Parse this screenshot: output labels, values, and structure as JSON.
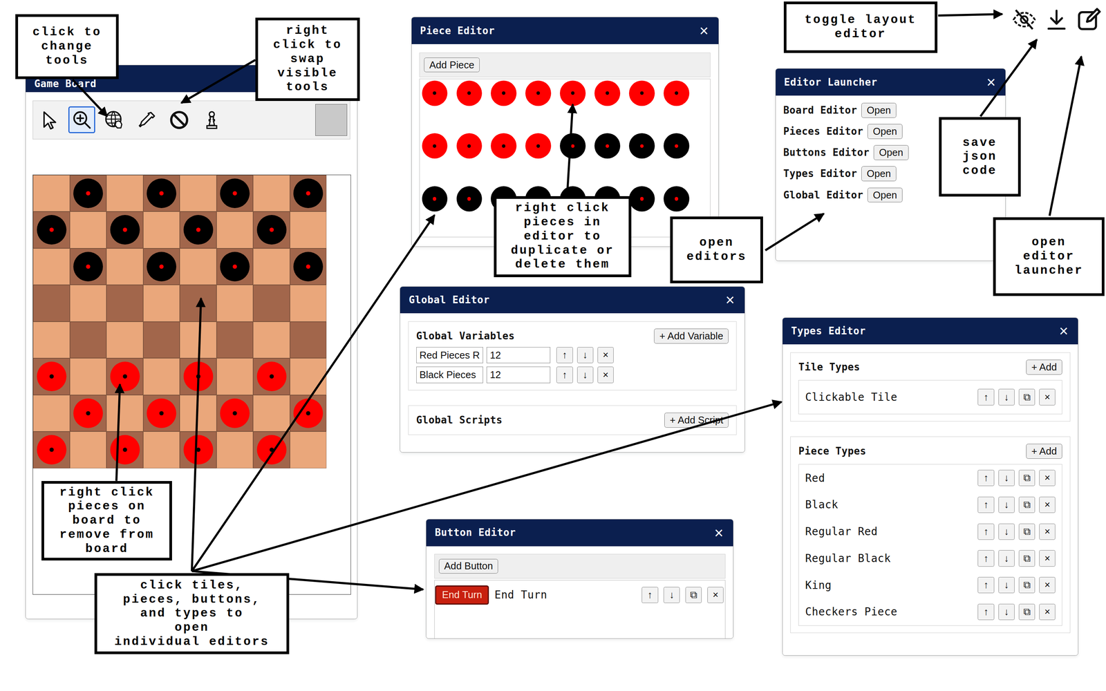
{
  "game_board": {
    "title": "Game Board",
    "tools": [
      {
        "kind": "pointer",
        "selected": false
      },
      {
        "kind": "zoom",
        "selected": true
      },
      {
        "kind": "pan",
        "selected": false
      },
      {
        "kind": "eyedropper",
        "selected": false
      },
      {
        "kind": "erase",
        "selected": false
      },
      {
        "kind": "piece",
        "selected": false
      }
    ],
    "board": [
      [
        {
          "kind": "light",
          "piece": "none"
        },
        {
          "kind": "dark",
          "piece": "black"
        },
        {
          "kind": "light",
          "piece": "none"
        },
        {
          "kind": "dark",
          "piece": "black"
        },
        {
          "kind": "light",
          "piece": "none"
        },
        {
          "kind": "dark",
          "piece": "black"
        },
        {
          "kind": "light",
          "piece": "none"
        },
        {
          "kind": "dark",
          "piece": "black"
        }
      ],
      [
        {
          "kind": "dark",
          "piece": "black"
        },
        {
          "kind": "light",
          "piece": "none"
        },
        {
          "kind": "dark",
          "piece": "black"
        },
        {
          "kind": "light",
          "piece": "none"
        },
        {
          "kind": "dark",
          "piece": "black"
        },
        {
          "kind": "light",
          "piece": "none"
        },
        {
          "kind": "dark",
          "piece": "black"
        },
        {
          "kind": "light",
          "piece": "none"
        }
      ],
      [
        {
          "kind": "light",
          "piece": "none"
        },
        {
          "kind": "dark",
          "piece": "black"
        },
        {
          "kind": "light",
          "piece": "none"
        },
        {
          "kind": "dark",
          "piece": "black"
        },
        {
          "kind": "light",
          "piece": "none"
        },
        {
          "kind": "dark",
          "piece": "black"
        },
        {
          "kind": "light",
          "piece": "none"
        },
        {
          "kind": "dark",
          "piece": "black"
        }
      ],
      [
        {
          "kind": "dark",
          "piece": "none"
        },
        {
          "kind": "light",
          "piece": "none"
        },
        {
          "kind": "dark",
          "piece": "none"
        },
        {
          "kind": "light",
          "piece": "none"
        },
        {
          "kind": "dark",
          "piece": "none"
        },
        {
          "kind": "light",
          "piece": "none"
        },
        {
          "kind": "dark",
          "piece": "none"
        },
        {
          "kind": "light",
          "piece": "none"
        }
      ],
      [
        {
          "kind": "light",
          "piece": "none"
        },
        {
          "kind": "dark",
          "piece": "none"
        },
        {
          "kind": "light",
          "piece": "none"
        },
        {
          "kind": "dark",
          "piece": "none"
        },
        {
          "kind": "light",
          "piece": "none"
        },
        {
          "kind": "dark",
          "piece": "none"
        },
        {
          "kind": "light",
          "piece": "none"
        },
        {
          "kind": "dark",
          "piece": "none"
        }
      ],
      [
        {
          "kind": "dark",
          "piece": "red"
        },
        {
          "kind": "light",
          "piece": "none"
        },
        {
          "kind": "dark",
          "piece": "red"
        },
        {
          "kind": "light",
          "piece": "none"
        },
        {
          "kind": "dark",
          "piece": "red"
        },
        {
          "kind": "light",
          "piece": "none"
        },
        {
          "kind": "dark",
          "piece": "red"
        },
        {
          "kind": "light",
          "piece": "none"
        }
      ],
      [
        {
          "kind": "light",
          "piece": "none"
        },
        {
          "kind": "dark",
          "piece": "red"
        },
        {
          "kind": "light",
          "piece": "none"
        },
        {
          "kind": "dark",
          "piece": "red"
        },
        {
          "kind": "light",
          "piece": "none"
        },
        {
          "kind": "dark",
          "piece": "red"
        },
        {
          "kind": "light",
          "piece": "none"
        },
        {
          "kind": "dark",
          "piece": "red"
        }
      ],
      [
        {
          "kind": "dark",
          "piece": "red"
        },
        {
          "kind": "light",
          "piece": "none"
        },
        {
          "kind": "dark",
          "piece": "red"
        },
        {
          "kind": "light",
          "piece": "none"
        },
        {
          "kind": "dark",
          "piece": "red"
        },
        {
          "kind": "light",
          "piece": "none"
        },
        {
          "kind": "dark",
          "piece": "red"
        },
        {
          "kind": "light",
          "piece": "none"
        }
      ]
    ]
  },
  "piece_editor": {
    "title": "Piece Editor",
    "close": "×",
    "add": "Add Piece",
    "pieces": [
      {
        "kind": "red"
      },
      {
        "kind": "red"
      },
      {
        "kind": "red"
      },
      {
        "kind": "red"
      },
      {
        "kind": "red"
      },
      {
        "kind": "red"
      },
      {
        "kind": "red"
      },
      {
        "kind": "red"
      },
      {
        "kind": "red"
      },
      {
        "kind": "red"
      },
      {
        "kind": "red"
      },
      {
        "kind": "red"
      },
      {
        "kind": "black"
      },
      {
        "kind": "black"
      },
      {
        "kind": "black"
      },
      {
        "kind": "black"
      },
      {
        "kind": "black"
      },
      {
        "kind": "black"
      },
      {
        "kind": "black"
      },
      {
        "kind": "black"
      },
      {
        "kind": "black"
      },
      {
        "kind": "black"
      },
      {
        "kind": "black"
      },
      {
        "kind": "black"
      }
    ]
  },
  "editor_launcher": {
    "title": "Editor Launcher",
    "close": "×",
    "items": [
      {
        "label": "Board Editor",
        "button": "Open"
      },
      {
        "label": "Pieces Editor",
        "button": "Open"
      },
      {
        "label": "Buttons Editor",
        "button": "Open"
      },
      {
        "label": "Types Editor",
        "button": "Open"
      },
      {
        "label": "Global Editor",
        "button": "Open"
      }
    ]
  },
  "global_editor": {
    "title": "Global Editor",
    "close": "×",
    "variables_title": "Global Variables",
    "add_variable": "+ Add Variable",
    "variables": [
      {
        "name": "Red Pieces R",
        "value": "12",
        "controls": [
          "↑",
          "↓",
          "×"
        ]
      },
      {
        "name": "Black Pieces",
        "value": "12",
        "controls": [
          "↑",
          "↓",
          "×"
        ]
      }
    ],
    "scripts_title": "Global Scripts",
    "add_script": "+ Add Script"
  },
  "button_editor": {
    "title": "Button Editor",
    "close": "×",
    "add": "Add Button",
    "items": [
      {
        "button": "End Turn",
        "label": "End Turn",
        "controls": [
          "↑",
          "↓",
          "⧉",
          "×"
        ]
      }
    ]
  },
  "types_editor": {
    "title": "Types Editor",
    "close": "×",
    "sections": [
      {
        "title": "Tile Types",
        "add": "+ Add",
        "items": [
          {
            "label": "Clickable Tile",
            "controls": [
              "↑",
              "↓",
              "⧉",
              "×"
            ]
          }
        ]
      },
      {
        "title": "Piece Types",
        "add": "+ Add",
        "items": [
          {
            "label": "Red",
            "controls": [
              "↑",
              "↓",
              "⧉",
              "×"
            ]
          },
          {
            "label": "Black",
            "controls": [
              "↑",
              "↓",
              "⧉",
              "×"
            ]
          },
          {
            "label": "Regular Red",
            "controls": [
              "↑",
              "↓",
              "⧉",
              "×"
            ]
          },
          {
            "label": "Regular Black",
            "controls": [
              "↑",
              "↓",
              "⧉",
              "×"
            ]
          },
          {
            "label": "King",
            "controls": [
              "↑",
              "↓",
              "⧉",
              "×"
            ]
          },
          {
            "label": "Checkers Piece",
            "controls": [
              "↑",
              "↓",
              "⧉",
              "×"
            ]
          }
        ]
      }
    ]
  },
  "annotations": [
    {
      "lines": [
        "click to",
        "change",
        "tools"
      ]
    },
    {
      "lines": [
        "right",
        "click to",
        "swap",
        "visible",
        "tools"
      ]
    },
    {
      "lines": [
        "toggle layout",
        "editor"
      ]
    },
    {
      "lines": [
        "save",
        "json",
        "code"
      ]
    },
    {
      "lines": [
        "open",
        "editor",
        "launcher"
      ]
    },
    {
      "lines": [
        "open",
        "editors"
      ]
    },
    {
      "lines": [
        "right click",
        "pieces in",
        "editor to",
        "duplicate or",
        "delete them"
      ]
    },
    {
      "lines": [
        "right click",
        "pieces on",
        "board to",
        "remove from",
        "board"
      ]
    },
    {
      "lines": [
        "click tiles,",
        "pieces, buttons,",
        "and types to",
        "open",
        "individual editors"
      ]
    }
  ]
}
